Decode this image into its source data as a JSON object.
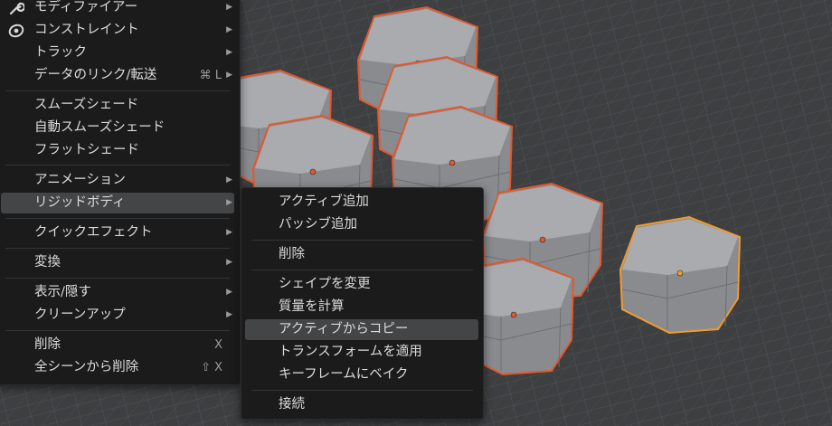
{
  "main_menu": {
    "items": [
      {
        "label": "モディファイアー",
        "icon": "wrench-icon"
      },
      {
        "label": "コンストレイント",
        "icon": "constraint-icon"
      },
      {
        "label": "トラック"
      },
      {
        "label": "データのリンク/転送",
        "shortcut": "⌘ L"
      },
      {
        "label": "スムーズシェード"
      },
      {
        "label": "自動スムーズシェード"
      },
      {
        "label": "フラットシェード"
      },
      {
        "label": "アニメーション"
      },
      {
        "label": "リジッドボディ"
      },
      {
        "label": "クイックエフェクト"
      },
      {
        "label": "変換"
      },
      {
        "label": "表示/隠す"
      },
      {
        "label": "クリーンアップ"
      },
      {
        "label": "削除",
        "shortcut": "X"
      },
      {
        "label": "全シーンから削除",
        "shortcut": "⇧ X"
      }
    ]
  },
  "submenu": {
    "items": [
      {
        "label": "アクティブ追加"
      },
      {
        "label": "パッシブ追加"
      },
      {
        "label": "削除"
      },
      {
        "label": "シェイプを変更"
      },
      {
        "label": "質量を計算"
      },
      {
        "label": "アクティブからコピー"
      },
      {
        "label": "トランスフォームを適用"
      },
      {
        "label": "キーフレームにベイク"
      },
      {
        "label": "接続"
      }
    ]
  },
  "colors": {
    "selected_outline": "#e2582c",
    "active_outline": "#f39a2e",
    "menu_bg": "#1b1b1c",
    "highlight_bg": "#444547",
    "grid": "#5a5c5f",
    "viewport_bg": "#3a3b3d"
  }
}
